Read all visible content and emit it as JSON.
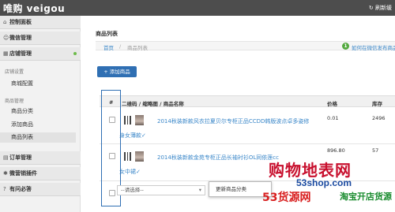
{
  "header": {
    "brand": "唯购 veigou",
    "refresh_label": "刷新缓"
  },
  "sidebar": {
    "sections": [
      {
        "icon": "home-icon",
        "label": "控制面板"
      },
      {
        "icon": "wechat-icon",
        "label": "微信管理"
      },
      {
        "icon": "grid-icon",
        "label": "店铺管理"
      }
    ],
    "shop_settings_group": "店铺设置",
    "shop_settings_items": [
      "商城配置"
    ],
    "goods_group": "商品管理",
    "goods_items": [
      "商品分类",
      "添加商品",
      "商品列表"
    ],
    "bottom_sections": [
      {
        "icon": "order-icon",
        "label": "订单管理"
      },
      {
        "icon": "plugin-icon",
        "label": "微营销插件"
      },
      {
        "icon": "question-icon",
        "label": "有问必答"
      }
    ]
  },
  "main": {
    "page_title": "商品列表",
    "breadcrumb": {
      "home": "首页",
      "sep": "/",
      "current": "商品列表"
    },
    "help": {
      "badge": "1",
      "text": "如何在微信发布商品"
    },
    "add_button": "+ 添加商品",
    "table": {
      "headers": [
        "#",
        "二维码 / 缩略图 / 商品名称",
        "价格",
        "库存"
      ],
      "rows": [
        {
          "name_line1": "2014秋装新款风衣拉夏贝尔专柜正品CCDD韩版波点卓多姿修",
          "name_line2": "身女薄款✓",
          "price": "0.01",
          "stock": "2496"
        },
        {
          "name_line1": "2014秋装新款金苑专柜正品长袖衬衫OL同依莲cc",
          "name_line2": "女中裙✓",
          "price": "896.80",
          "stock": "57"
        }
      ]
    },
    "bottom_select": "--请选择--",
    "batch_button": "更新商品分类"
  },
  "watermark": {
    "line1": "购物地表网",
    "line2": "53shop.com",
    "line3": "53货源网",
    "line4": "淘宝开店货源"
  }
}
